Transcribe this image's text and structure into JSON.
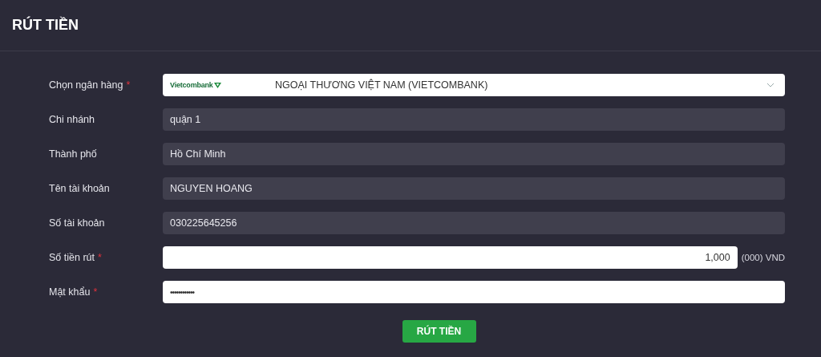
{
  "title": "RÚT TIỀN",
  "fields": [
    {
      "kind": "select",
      "label": "Chọn ngân hàng",
      "required": true,
      "logo": "Vietcombank",
      "value": "NGOẠI THƯƠNG VIỆT NAM (VIETCOMBANK)"
    },
    {
      "kind": "readonly",
      "label": "Chi nhánh",
      "required": false,
      "value": "quận 1"
    },
    {
      "kind": "readonly",
      "label": "Thành phố",
      "required": false,
      "value": "Hồ Chí Minh"
    },
    {
      "kind": "readonly",
      "label": "Tên tài khoản",
      "required": false,
      "value": "NGUYEN HOANG"
    },
    {
      "kind": "readonly",
      "label": "Số tài khoản",
      "required": false,
      "value": "030225645256"
    },
    {
      "kind": "amount",
      "label": "Số tiền rút",
      "required": true,
      "value": "1,000",
      "suffix": "(000) VND"
    },
    {
      "kind": "password",
      "label": "Mật khẩu",
      "required": true,
      "value": "••••••••••••"
    }
  ],
  "required_mark": "*",
  "submit": "RÚT TIỀN"
}
